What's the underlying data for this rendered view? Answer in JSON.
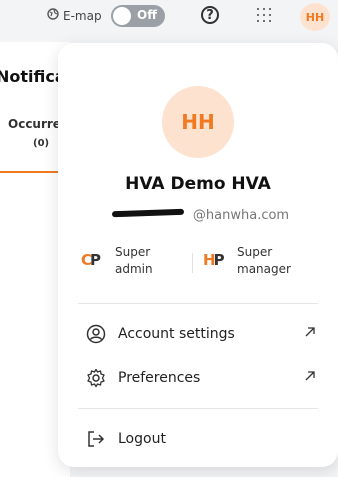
{
  "topbar": {
    "emap_label": "E-map",
    "emap_toggle_state": "Off",
    "avatar_initials": "HH"
  },
  "background_page": {
    "title": "Notifica",
    "tab_label": "Occurre",
    "tab_count": "(0)"
  },
  "profile_menu": {
    "avatar_initials": "HH",
    "user_name": "HVA Demo HVA",
    "email_visible": "@hanwha.com",
    "roles": [
      {
        "logo": "CP",
        "label_line1": "Super",
        "label_line2": "admin"
      },
      {
        "logo": "HP",
        "label_line1": "Super",
        "label_line2": "manager"
      }
    ],
    "items": [
      {
        "label": "Account settings",
        "icon": "account-circle-icon",
        "trailing": "external-link-icon"
      },
      {
        "label": "Preferences",
        "icon": "gear-icon",
        "trailing": "external-link-icon"
      },
      {
        "label": "Logout",
        "icon": "logout-icon"
      }
    ]
  },
  "colors": {
    "accent": "#f07a22",
    "avatar_bg": "#fde3cf",
    "toggle_off": "#9aa0a6"
  }
}
